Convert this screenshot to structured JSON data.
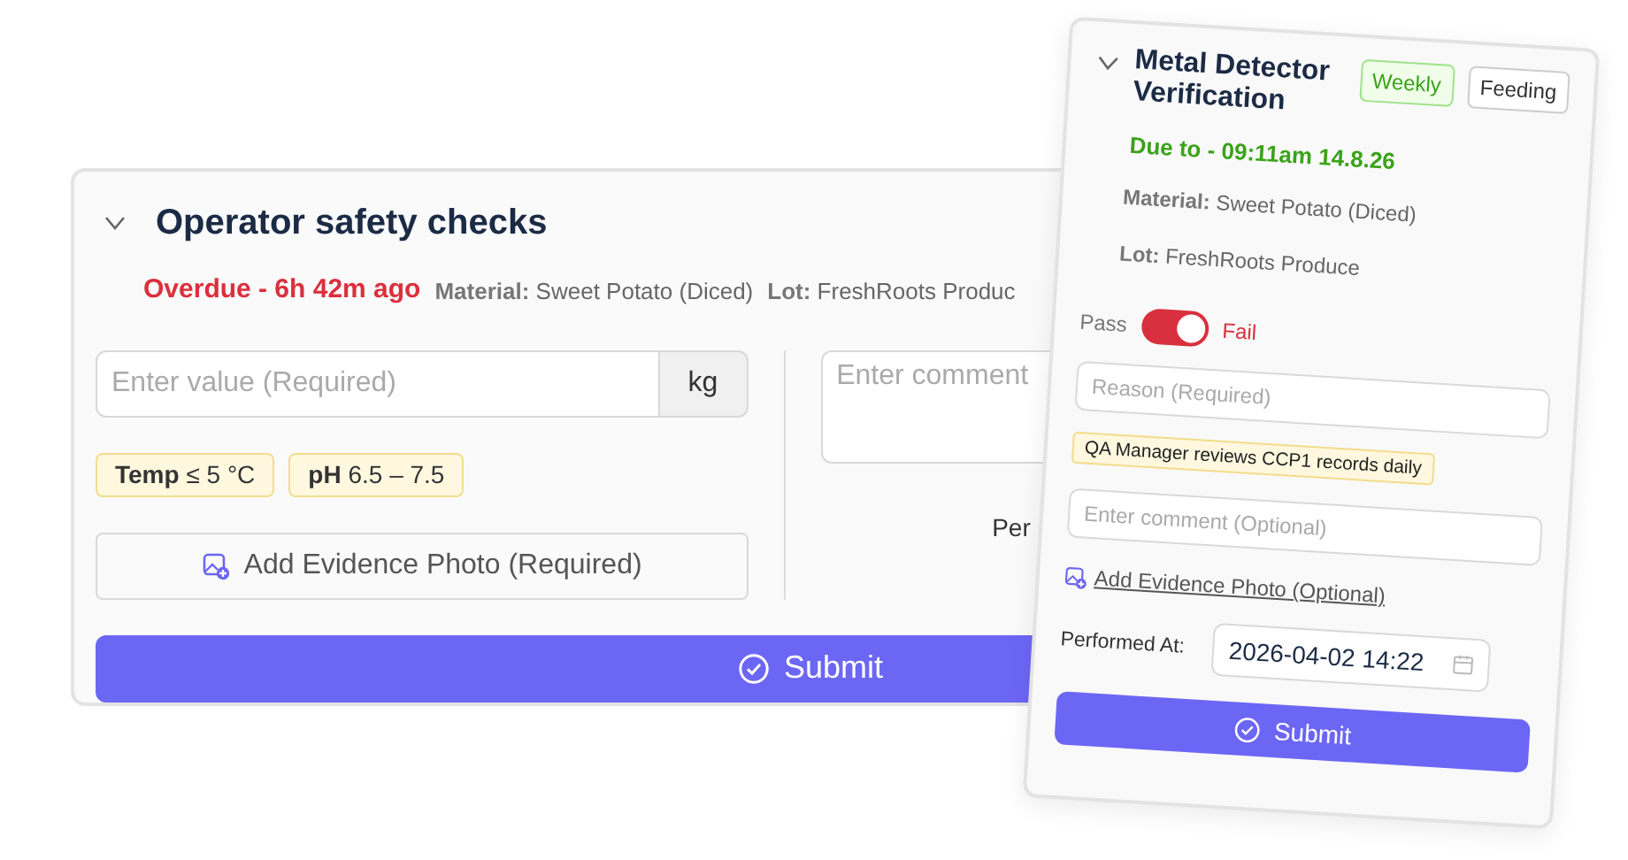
{
  "checklist_card": {
    "title": "Operator safety checks",
    "expanded": true,
    "status": {
      "kind": "overdue",
      "text": "Overdue - 6h 42m ago"
    },
    "meta": [
      {
        "label": "Material:",
        "value": "Sweet Potato (Diced)"
      },
      {
        "label": "Lot:",
        "value": "FreshRoots Produc"
      }
    ],
    "value_field": {
      "placeholder": "Enter value (Required)",
      "unit": "kg"
    },
    "limits": [
      "**Temp** ≤ 5 °C",
      "**pH** 6.5 – 7.5"
    ],
    "photo_button": "Add Evidence Photo (Required)",
    "comment_field": {
      "placeholder": "Enter comment"
    },
    "performed_label": "Per",
    "submit": "Submit"
  },
  "popup_card": {
    "title": "Metal Detector Verification",
    "expanded": true,
    "tags": [
      {
        "kind": "frequency",
        "text": "Weekly"
      },
      {
        "kind": "category",
        "text": "Feeding"
      }
    ],
    "status": {
      "kind": "due",
      "text": "Due to - 09:11am 14.8.26"
    },
    "meta": [
      {
        "label": "Material:",
        "value": "Sweet Potato (Diced)"
      },
      {
        "label": "Lot:",
        "value": "FreshRoots Produce"
      }
    ],
    "toggle": {
      "off_label": "Pass",
      "on_label": "Fail",
      "on": true
    },
    "reason_field": {
      "placeholder": "Reason (Required)"
    },
    "note": "QA Manager reviews CCP1 records daily",
    "comment_field": {
      "placeholder": "Enter comment (Optional)"
    },
    "photo_link": "Add Evidence Photo (Optional)",
    "performed_label": "Performed At:",
    "performed_value": "2026-04-02 14:22",
    "submit": "Submit"
  }
}
